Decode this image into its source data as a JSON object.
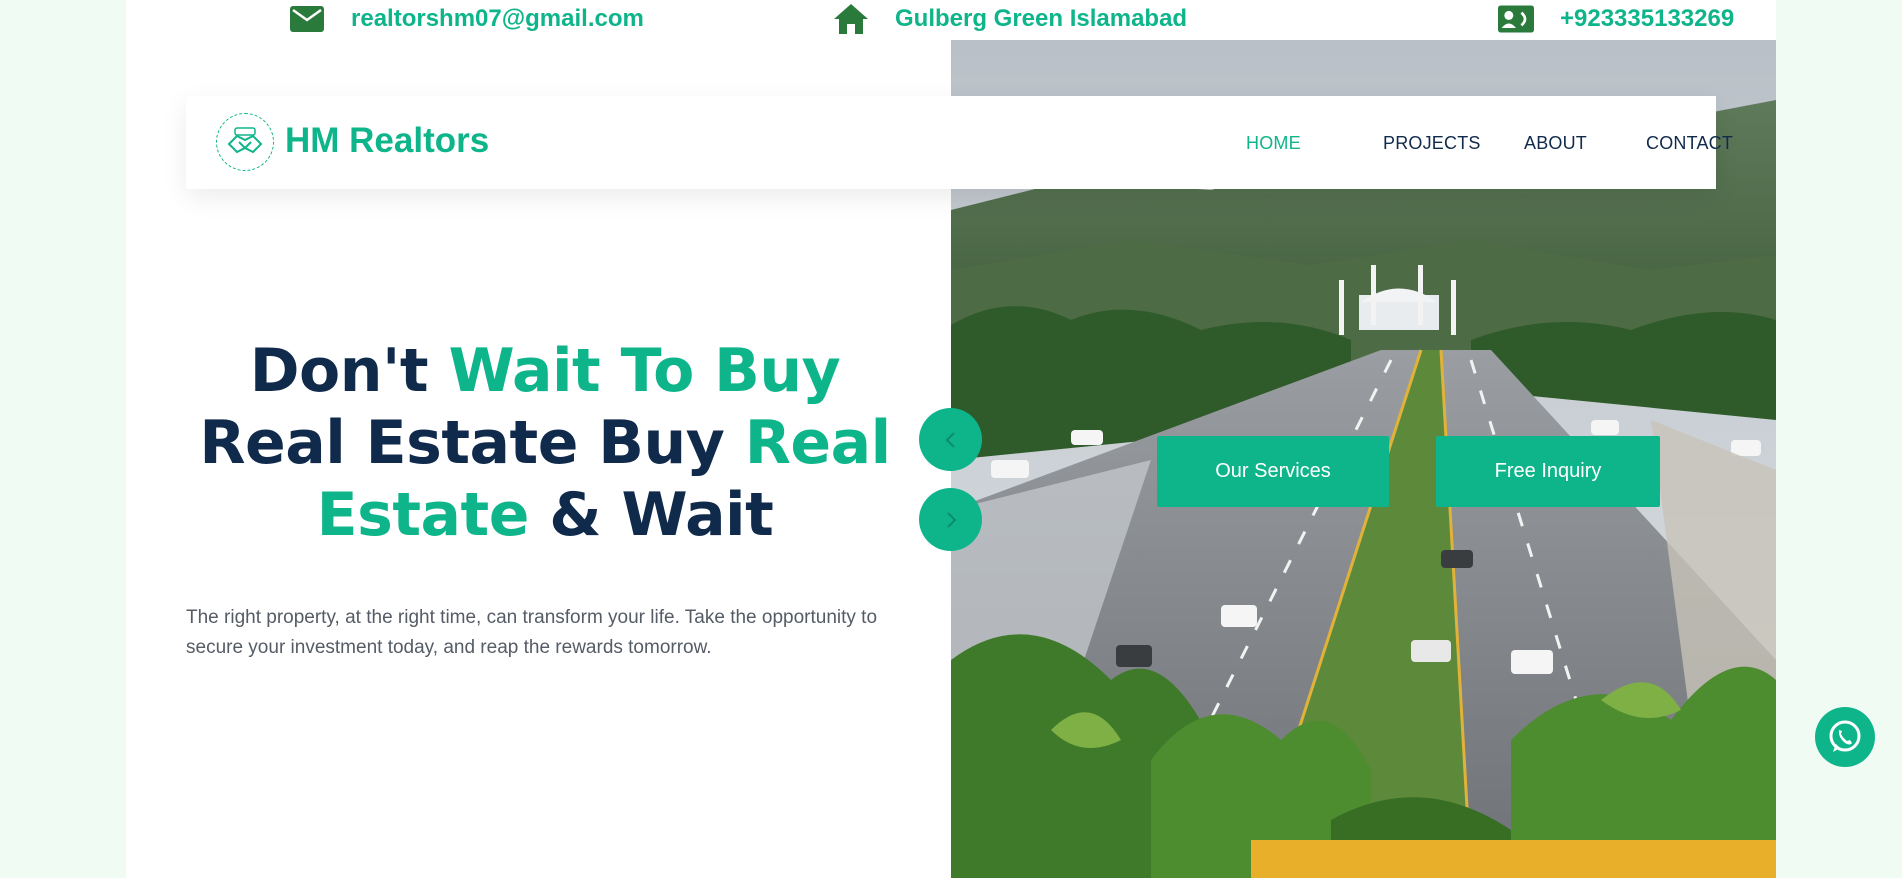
{
  "topbar": {
    "email": "realtorshm07@gmail.com",
    "address": "Gulberg Green Islamabad",
    "phone": "+923335133269"
  },
  "brand": {
    "name": "HM Realtors"
  },
  "nav": {
    "items": [
      {
        "label": "HOME",
        "active": true
      },
      {
        "label": "PROJECTS",
        "active": false
      },
      {
        "label": "ABOUT",
        "active": false
      },
      {
        "label": "CONTACT",
        "active": false
      }
    ]
  },
  "hero": {
    "headline": {
      "part1": "Don't ",
      "part2": "Wait To Buy",
      "part3": " Real Estate Buy ",
      "part4": "Real Estate",
      "part5": " & Wait"
    },
    "lede": "The right property, at the right time, can transform your life. Take the opportunity to secure your investment today, and reap the rewards tomorrow.",
    "buttons": {
      "services": "Our Services",
      "inquiry": "Free Inquiry"
    }
  },
  "icons": {
    "email": "envelope-icon",
    "address": "home-icon",
    "phone": "contact-card-icon",
    "prev": "chevron-left-icon",
    "next": "chevron-right-icon",
    "whatsapp": "whatsapp-icon"
  },
  "colors": {
    "accent": "#0fb58a",
    "navy": "#102a4c",
    "icon_green": "#2a7a3c",
    "page_bg": "#effbf3"
  }
}
